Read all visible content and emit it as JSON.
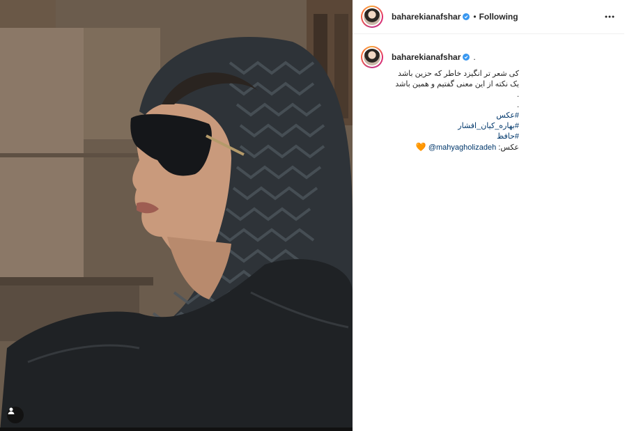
{
  "post": {
    "photo_alt": "",
    "tag_icon": "user-tag-icon"
  },
  "header": {
    "username": "baharekianafshar",
    "separator": "•",
    "follow_status": "Following",
    "more_icon": "more-options-icon",
    "verified_icon": "verified-badge-icon"
  },
  "comment": {
    "username": "baharekianafshar",
    "trailing": ".",
    "lines": [
      "کی شعر تر انگیزد خاطر که حزین باشد",
      "یک نکته از این معنی گفتیم و همین باشد",
      ".",
      "."
    ],
    "hashtags": [
      "#عکس",
      "#بهاره_کیان_افشار",
      "#حافظ"
    ],
    "credit_prefix": "عکس:",
    "mention": "@mahyagholizadeh",
    "emoji": "🧡"
  },
  "colors": {
    "link": "#00376b",
    "verified": "#3897f0",
    "text": "#262626",
    "divider": "#efefef"
  }
}
